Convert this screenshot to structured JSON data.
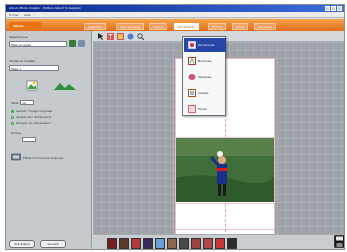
{
  "window": {
    "title": "Album Photo Creator - Edition Album Scrapbook",
    "menu": [
      "Fichier",
      "Aide"
    ]
  },
  "nav": {
    "logo": "Album",
    "tabs": [
      "Assistant",
      "Mise en page",
      "Cadres",
      "Ornements",
      "Photos",
      "Texte",
      "Imprimer"
    ],
    "active_tab": "Ornements"
  },
  "sidebar": {
    "section1_title": "Sélectionner",
    "section1_value": "Mise en page",
    "section2_title": "Choisir le modèle",
    "section2_value": "Page 1",
    "size_label": "Taille",
    "size_value": "10",
    "options": [
      "Garder l'image originale",
      "Ajuster aux dimensions",
      "Remplir les dimensions"
    ],
    "shadow_label": "Ombre",
    "effect_label": "Effets d'ornement avancés",
    "footer_buttons": [
      "Précédent",
      "Suivant"
    ]
  },
  "dropdown": {
    "items": [
      "Ornements",
      "Bordures",
      "Masques",
      "Cadres",
      "Fonds"
    ],
    "selected_index": 0
  },
  "colors": {
    "accent": "#e46d1c",
    "selection": "#2747a8",
    "page_border": "#f3b8c6"
  },
  "icons": {
    "toolbar": [
      "pointer-icon",
      "text-icon",
      "frame-icon",
      "shape-icon",
      "zoom-icon"
    ],
    "thumbnails": [
      "ornament-1",
      "ornament-2",
      "ornament-3",
      "ornament-4",
      "ornament-5",
      "ornament-6",
      "ornament-7",
      "ornament-8",
      "ornament-9",
      "ornament-10",
      "ornament-11"
    ]
  }
}
